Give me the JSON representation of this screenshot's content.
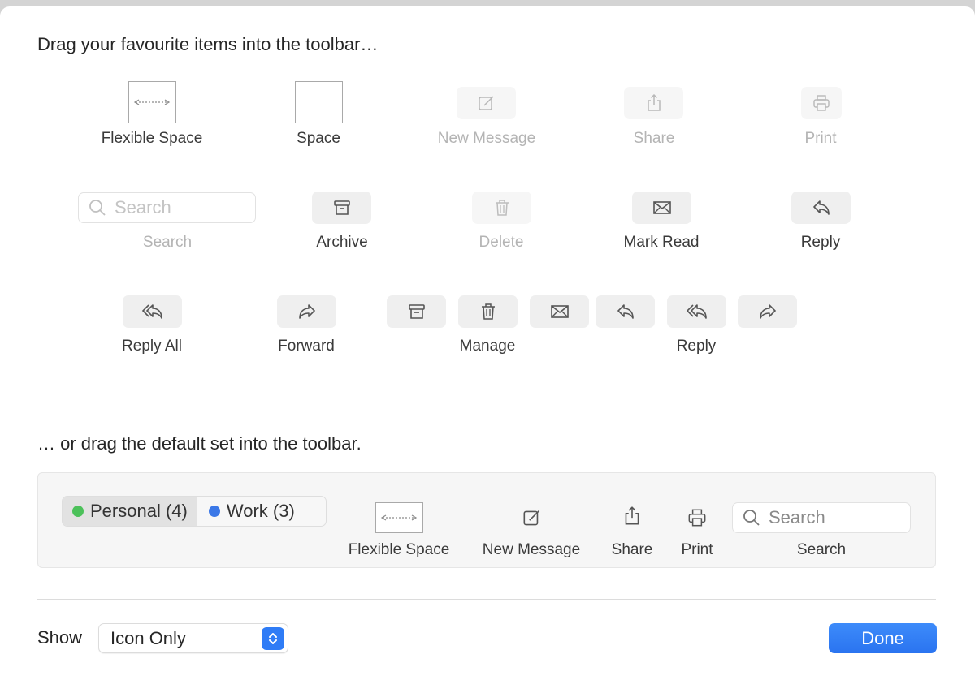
{
  "headings": {
    "favourites": "Drag your favourite items into the toolbar…",
    "default_set": "… or drag the default set into the toolbar."
  },
  "favourites": {
    "flexible_space": "Flexible Space",
    "space": "Space",
    "new_message": "New Message",
    "share": "Share",
    "print": "Print",
    "search_placeholder": "Search",
    "search": "Search",
    "archive": "Archive",
    "delete": "Delete",
    "mark_read": "Mark Read",
    "reply": "Reply",
    "reply_all": "Reply All",
    "forward": "Forward",
    "manage": "Manage",
    "reply_group": "Reply"
  },
  "default_set": {
    "mailboxes": [
      {
        "label": "Personal (4)",
        "color": "#4cc15a"
      },
      {
        "label": "Work (3)",
        "color": "#3b78e7"
      }
    ],
    "flexible_space": "Flexible Space",
    "new_message": "New Message",
    "share": "Share",
    "print": "Print",
    "search_placeholder": "Search",
    "search": "Search"
  },
  "footer": {
    "show_label": "Show",
    "show_value": "Icon Only",
    "done": "Done"
  },
  "colors": {
    "accent": "#2f7cf6",
    "panel": "#f6f6f6"
  }
}
